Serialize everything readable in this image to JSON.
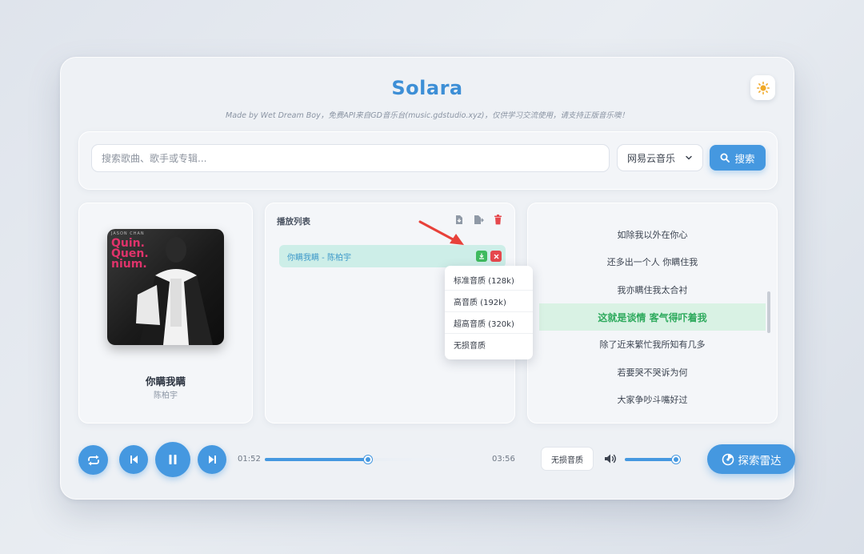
{
  "app": {
    "title": "Solara",
    "subtitle": "Made by Wet Dream Boy，免费API来自GD音乐台(music.gdstudio.xyz)，仅供学习交流使用，请支持正版音乐噢！",
    "theme_icon": "sun-icon"
  },
  "search": {
    "placeholder": "搜索歌曲、歌手或专辑...",
    "source": "网易云音乐",
    "button_label": "搜索"
  },
  "now_playing": {
    "title": "你瞒我瞒",
    "artist": "陈柏宇",
    "cover_top_text": "JASON CHAN",
    "cover_lines": [
      "Quin.",
      "Quen.",
      "nium."
    ]
  },
  "playlist": {
    "title": "播放列表",
    "header_icons": [
      "import-icon",
      "export-icon",
      "trash-icon"
    ],
    "items": [
      {
        "label": "你瞒我瞒 - 陈柏宇"
      }
    ],
    "quality_menu": [
      "标准音质 (128k)",
      "高音质 (192k)",
      "超高音质 (320k)",
      "无损音质"
    ]
  },
  "lyrics": {
    "lines": [
      "如除我以外在你心",
      "还多出一个人 你瞒住我",
      "我亦瞒住我太合衬",
      "这就是谈情 客气得吓着我",
      "除了近来繁忙我所知有几多",
      "若要哭不哭诉为何",
      "大家争吵斗嘴好过"
    ],
    "active_index": 3
  },
  "player": {
    "current_time": "01:52",
    "total_time": "03:56",
    "progress": 0.475,
    "quality": "无损音质",
    "volume": 0.9,
    "radar_label": "探索雷达"
  },
  "colors": {
    "accent": "#4598e0",
    "active_lyric": "#2eaa5d",
    "download": "#3fba5e",
    "delete": "#e5484d",
    "arrow": "#e8413a"
  }
}
